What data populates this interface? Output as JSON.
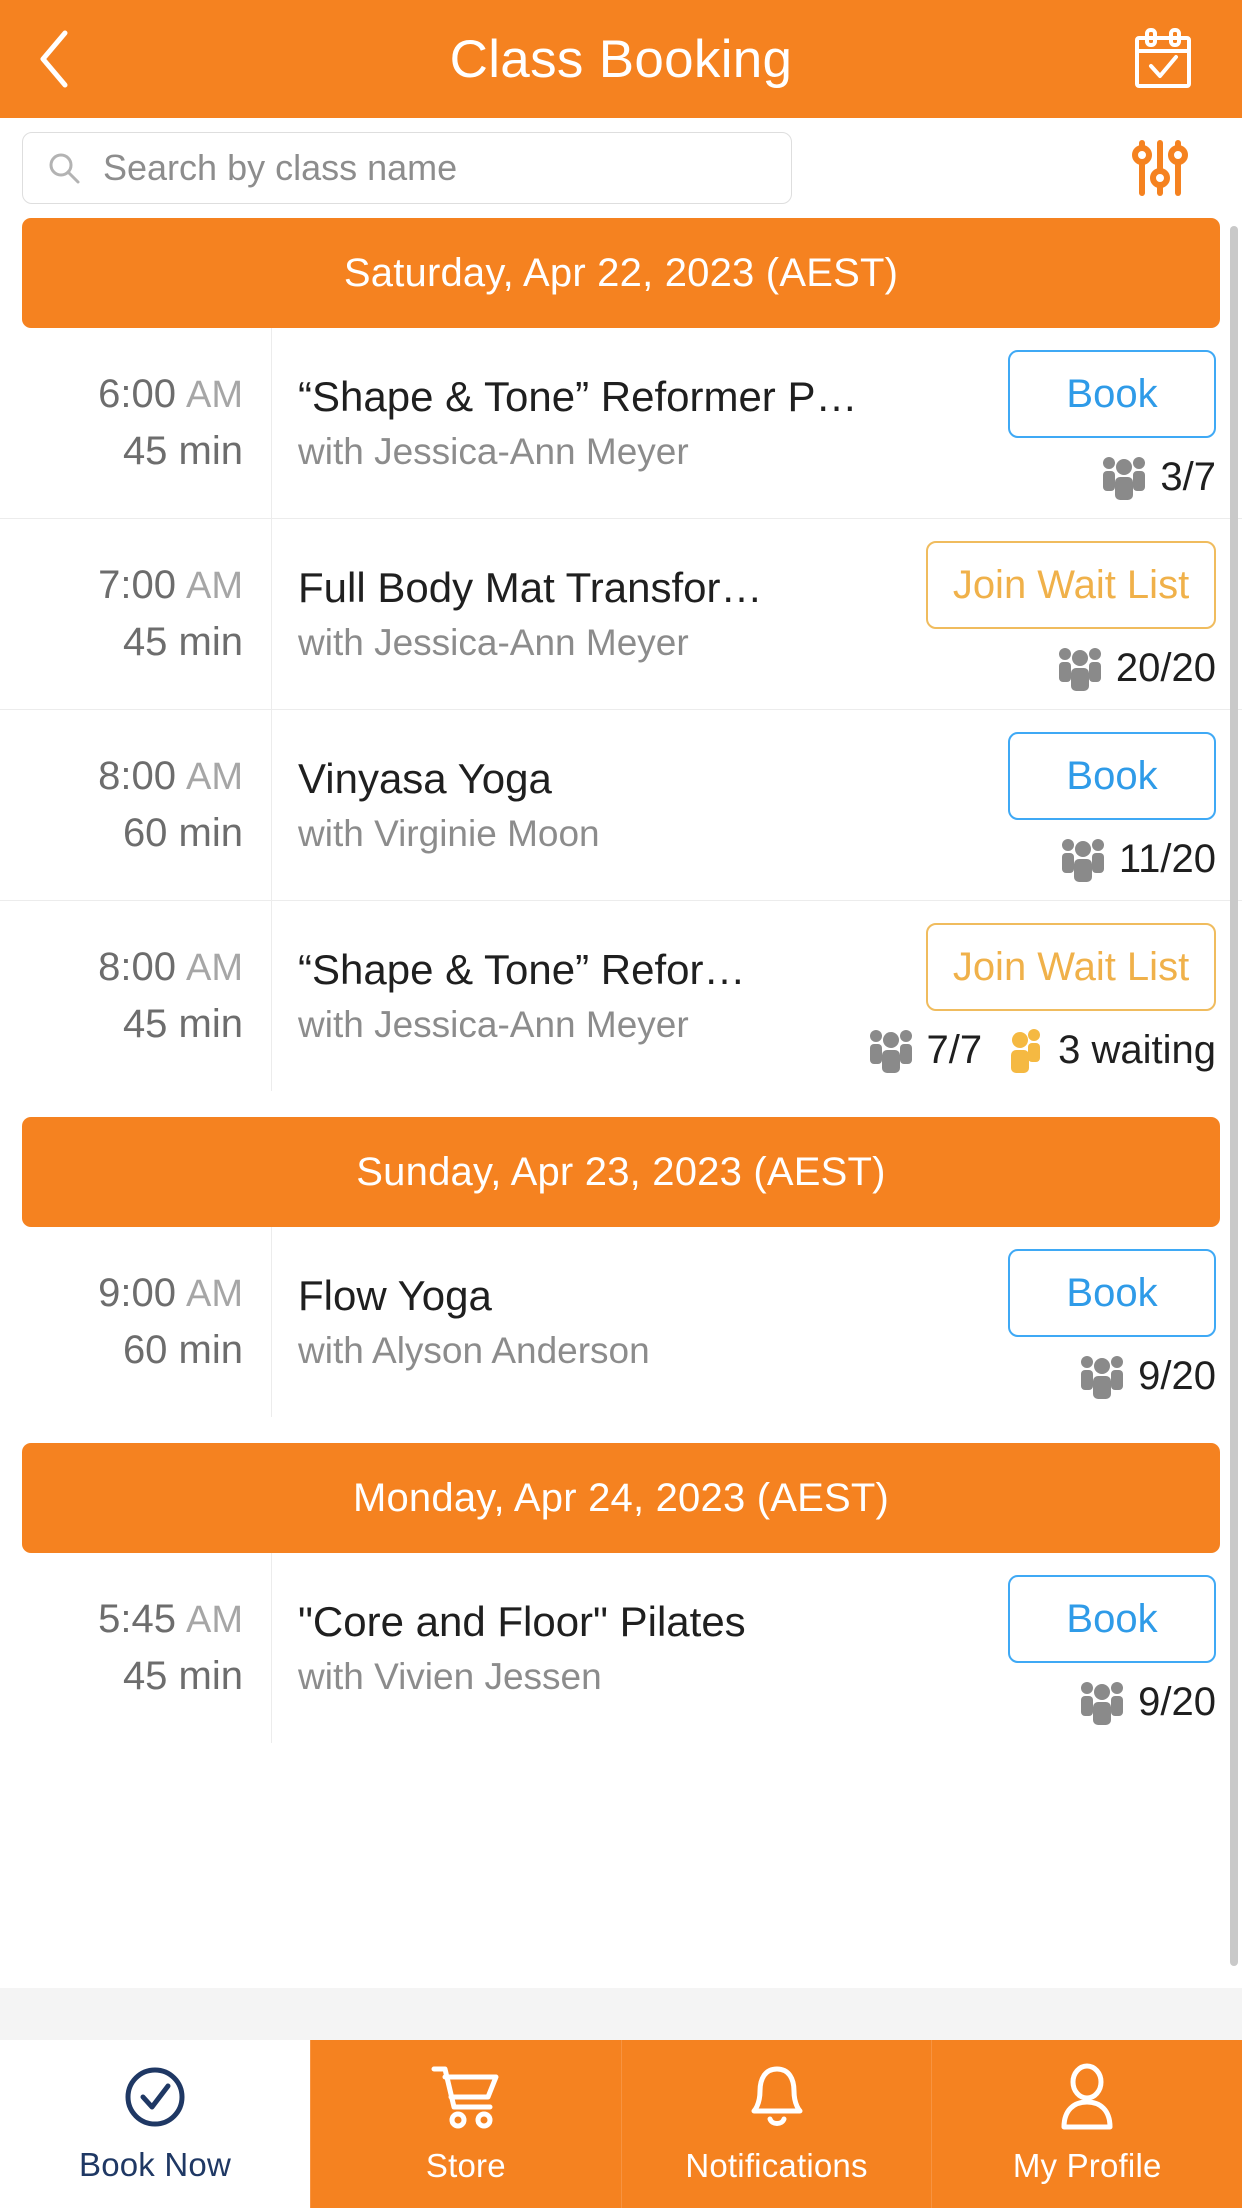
{
  "header": {
    "title": "Class Booking",
    "back_icon": "chevron-left-icon",
    "calendar_icon": "calendar-check-icon"
  },
  "search": {
    "placeholder": "Search by class name",
    "value": "",
    "search_icon": "search-icon",
    "filter_icon": "filter-sliders-icon"
  },
  "colors": {
    "brand_orange": "#F58220",
    "book_blue": "#3FA9F5",
    "wait_amber": "#F0B14A",
    "active_nav": "#1F3864"
  },
  "groups": [
    {
      "date_label": "Saturday, Apr 22, 2023 (AEST)",
      "classes": [
        {
          "time": "6:00",
          "ampm": "AM",
          "duration": "45 min",
          "title": "“Shape & Tone” Reformer P…",
          "instructor": "with Jessica-Ann Meyer",
          "action_label": "Book",
          "action_type": "book",
          "capacity": "3/7",
          "capacity_icon": "people-group-icon",
          "waiting": null,
          "waiting_icon": null
        },
        {
          "time": "7:00",
          "ampm": "AM",
          "duration": "45 min",
          "title": "Full Body Mat Transfor…",
          "instructor": "with Jessica-Ann Meyer",
          "action_label": "Join Wait List",
          "action_type": "waitlist",
          "capacity": "20/20",
          "capacity_icon": "people-group-icon",
          "waiting": null,
          "waiting_icon": null
        },
        {
          "time": "8:00",
          "ampm": "AM",
          "duration": "60 min",
          "title": "Vinyasa Yoga",
          "instructor": "with Virginie Moon",
          "action_label": "Book",
          "action_type": "book",
          "capacity": "11/20",
          "capacity_icon": "people-group-icon",
          "waiting": null,
          "waiting_icon": null
        },
        {
          "time": "8:00",
          "ampm": "AM",
          "duration": "45 min",
          "title": "“Shape & Tone” Refor…",
          "instructor": "with Jessica-Ann Meyer",
          "action_label": "Join Wait List",
          "action_type": "waitlist",
          "capacity": "7/7",
          "capacity_icon": "people-group-icon",
          "waiting": "3 waiting",
          "waiting_icon": "people-waiting-icon"
        }
      ]
    },
    {
      "date_label": "Sunday, Apr 23, 2023 (AEST)",
      "classes": [
        {
          "time": "9:00",
          "ampm": "AM",
          "duration": "60 min",
          "title": "Flow Yoga",
          "instructor": "with Alyson Anderson",
          "action_label": "Book",
          "action_type": "book",
          "capacity": "9/20",
          "capacity_icon": "people-group-icon",
          "waiting": null,
          "waiting_icon": null
        }
      ]
    },
    {
      "date_label": "Monday, Apr 24, 2023 (AEST)",
      "classes": [
        {
          "time": "5:45",
          "ampm": "AM",
          "duration": "45 min",
          "title": "\"Core and Floor\" Pilates",
          "instructor": "with Vivien Jessen",
          "action_label": "Book",
          "action_type": "book",
          "capacity": "9/20",
          "capacity_icon": "people-group-icon",
          "waiting": null,
          "waiting_icon": null
        }
      ]
    }
  ],
  "bottom_nav": [
    {
      "label": "Book Now",
      "icon": "check-circle-icon",
      "active": true
    },
    {
      "label": "Store",
      "icon": "shopping-cart-icon",
      "active": false
    },
    {
      "label": "Notifications",
      "icon": "bell-icon",
      "active": false
    },
    {
      "label": "My Profile",
      "icon": "user-icon",
      "active": false
    }
  ]
}
